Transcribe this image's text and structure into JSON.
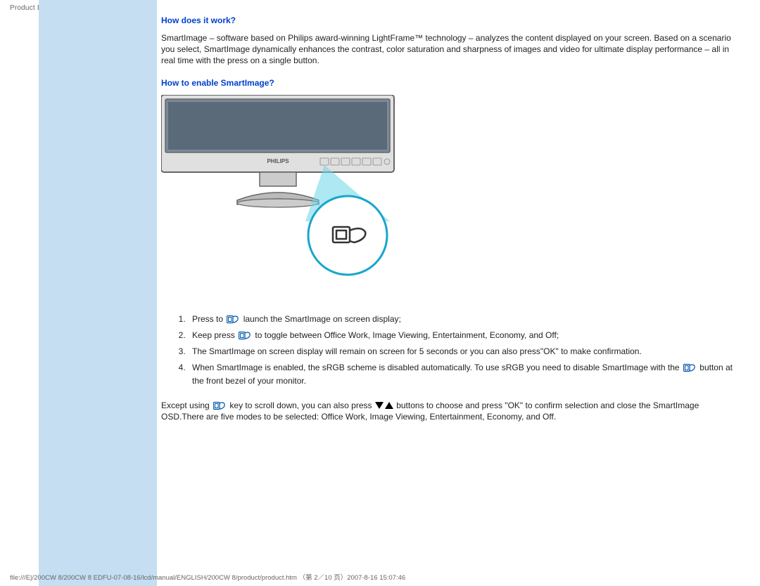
{
  "header": "Product Information",
  "h1": "How does it work?",
  "p1": "SmartImage – software based on Philips award-winning LightFrame™ technology – analyzes the content displayed on your screen. Based on a scenario you select, SmartImage dynamically enhances the contrast, color saturation and sharpness of images and video for ultimate display performance – all in real time with the press on a single button.",
  "h2": "How to enable SmartImage?",
  "monitor_brand": "PHILIPS",
  "steps": {
    "s1a": "Press to",
    "s1b": "launch the SmartImage on screen display;",
    "s2a": "Keep press",
    "s2b": "to toggle between Office Work, Image Viewing, Entertainment, Economy, and Off;",
    "s3": "The SmartImage on screen display will remain on screen for 5 seconds or you can also press\"OK\" to make confirmation.",
    "s4a": "When SmartImage is enabled, the sRGB scheme is disabled automatically. To use sRGB you need to disable SmartImage with the",
    "s4b": "button at the front bezel of your monitor."
  },
  "p2a": "Except using",
  "p2b": "key to scroll down, you can also press",
  "p2c": "buttons to choose and press \"OK\" to confirm selection and close the SmartImage OSD.There are five modes to be selected: Office Work, Image Viewing, Entertainment, Economy, and Off.",
  "footer": "file:///E|/200CW 8/200CW 8 EDFU-07-08-16/lcd/manual/ENGLISH/200CW 8/product/product.htm （第 2／10 页）2007-8-16 15:07:46"
}
